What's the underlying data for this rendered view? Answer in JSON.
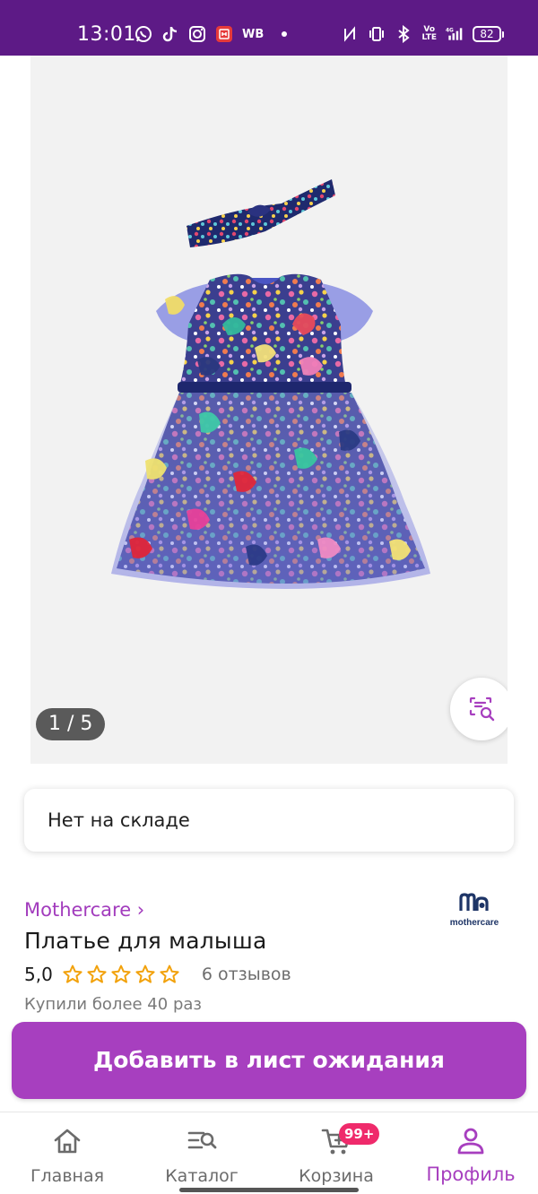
{
  "status_bar": {
    "time": "13:01",
    "left_icons": [
      "whatsapp-icon",
      "tiktok-icon",
      "instagram-icon",
      "app-icon"
    ],
    "wb_label": "WB",
    "right_icons": [
      "nfc-icon",
      "vibrate-icon",
      "bluetooth-icon",
      "volte-icon",
      "signal-4g-icon"
    ],
    "volte_top": "Vo",
    "volte_bottom": "LTE",
    "battery": "82",
    "background": "#5d1a86"
  },
  "gallery": {
    "counter": "1 / 5",
    "visual_search_icon": "visual-search-icon"
  },
  "stock": {
    "label": "Нет на складе"
  },
  "product": {
    "brand": "Mothercare ›",
    "brand_logo_text": "mothercare",
    "title": "Платье для малыша",
    "rating": "5,0",
    "stars": 5,
    "reviews": "6 отзывов",
    "bought": "Купили более 40 раз"
  },
  "waitlist_button": {
    "label": "Добавить в лист ожидания",
    "color": "#a73fbf"
  },
  "bottom_nav": {
    "items": [
      {
        "label": "Главная",
        "icon": "home-icon"
      },
      {
        "label": "Каталог",
        "icon": "catalog-search-icon"
      },
      {
        "label": "Корзина",
        "icon": "cart-icon",
        "badge": "99+"
      },
      {
        "label": "Профиль",
        "icon": "profile-icon",
        "active": true
      }
    ],
    "accent": "#a73fbf",
    "badge_color": "#ef2a6b"
  }
}
